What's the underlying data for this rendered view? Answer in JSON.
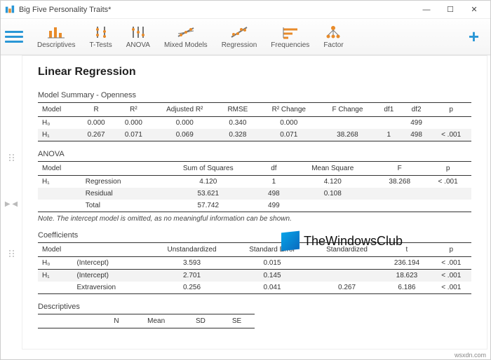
{
  "window": {
    "title": "Big Five Personality Traits*"
  },
  "toolbar": {
    "items": [
      {
        "label": "Descriptives"
      },
      {
        "label": "T-Tests"
      },
      {
        "label": "ANOVA"
      },
      {
        "label": "Mixed Models"
      },
      {
        "label": "Regression"
      },
      {
        "label": "Frequencies"
      },
      {
        "label": "Factor"
      }
    ]
  },
  "page": {
    "title": "Linear Regression",
    "model_summary": {
      "title": "Model Summary - Openness",
      "headers": [
        "Model",
        "R",
        "R²",
        "Adjusted R²",
        "RMSE",
        "R² Change",
        "F Change",
        "df1",
        "df2",
        "p"
      ],
      "rows": [
        {
          "model": "H₀",
          "R": "0.000",
          "R2": "0.000",
          "AdjR2": "0.000",
          "RMSE": "0.340",
          "R2Chg": "0.000",
          "FChg": "",
          "df1": "",
          "df2": "499",
          "p": ""
        },
        {
          "model": "H₁",
          "R": "0.267",
          "R2": "0.071",
          "AdjR2": "0.069",
          "RMSE": "0.328",
          "R2Chg": "0.071",
          "FChg": "38.268",
          "df1": "1",
          "df2": "498",
          "p": "< .001"
        }
      ]
    },
    "anova": {
      "title": "ANOVA",
      "headers": [
        "Model",
        "",
        "Sum of Squares",
        "df",
        "Mean Square",
        "F",
        "p"
      ],
      "group": "H₁",
      "rows": [
        {
          "term": "Regression",
          "SS": "4.120",
          "df": "1",
          "MS": "4.120",
          "F": "38.268",
          "p": "< .001"
        },
        {
          "term": "Residual",
          "SS": "53.621",
          "df": "498",
          "MS": "0.108",
          "F": "",
          "p": ""
        },
        {
          "term": "Total",
          "SS": "57.742",
          "df": "499",
          "MS": "",
          "F": "",
          "p": ""
        }
      ],
      "note": "Note. The intercept model is omitted, as no meaningful information can be shown."
    },
    "coefficients": {
      "title": "Coefficients",
      "headers": [
        "Model",
        "",
        "Unstandardized",
        "Standard Error",
        "Standardized",
        "t",
        "p"
      ],
      "rows": [
        {
          "model": "H₀",
          "term": "(Intercept)",
          "B": "3.593",
          "SE": "0.015",
          "Std": "",
          "t": "236.194",
          "p": "< .001"
        },
        {
          "model": "H₁",
          "term": "(Intercept)",
          "B": "2.701",
          "SE": "0.145",
          "Std": "",
          "t": "18.623",
          "p": "< .001"
        },
        {
          "model": "",
          "term": "Extraversion",
          "B": "0.256",
          "SE": "0.041",
          "Std": "0.267",
          "t": "6.186",
          "p": "< .001"
        }
      ]
    },
    "descriptives": {
      "title": "Descriptives",
      "headers": [
        "",
        "N",
        "Mean",
        "SD",
        "SE"
      ]
    }
  },
  "watermark": {
    "text": "TheWindowsClub",
    "domain": "wsxdn.com"
  }
}
